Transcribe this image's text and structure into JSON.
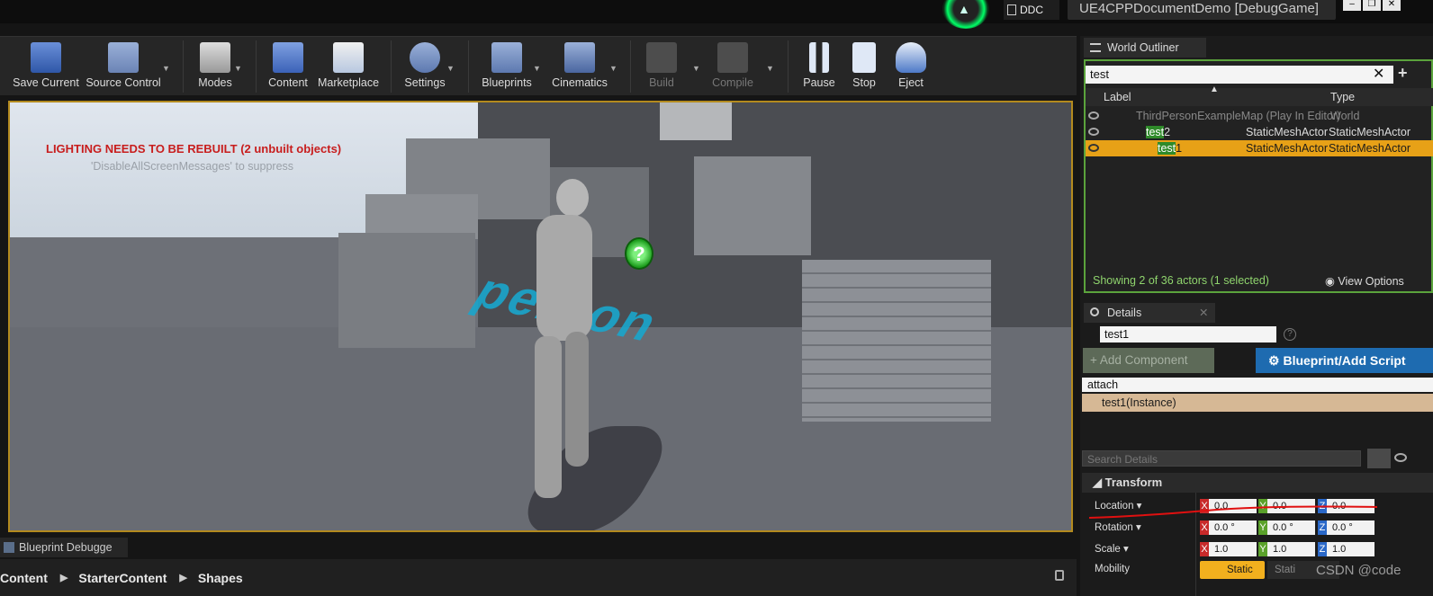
{
  "titlebar": {
    "ddc_label": "DDC",
    "project_tab": "UE4CPPDocumentDemo [DebugGame]",
    "win_buttons": [
      "–",
      "❐",
      "✕"
    ]
  },
  "toolbar": {
    "save": "Save Current",
    "source": "Source Control",
    "modes": "Modes",
    "content": "Content",
    "marketplace": "Marketplace",
    "settings": "Settings",
    "blueprints": "Blueprints",
    "cinematics": "Cinematics",
    "build": "Build",
    "compile": "Compile",
    "pause": "Pause",
    "stop": "Stop",
    "eject": "Eject"
  },
  "viewport": {
    "warning": "LIGHTING NEEDS TO BE REBUILT (2 unbuilt objects)",
    "hint": "'DisableAllScreenMessages' to suppress",
    "floor_text": "person",
    "marker": "?"
  },
  "bottom": {
    "tab": "Blueprint Debugge",
    "path": [
      "Content",
      "StarterContent",
      "Shapes"
    ]
  },
  "outliner": {
    "tab": "World Outliner",
    "search": "test",
    "col_label": "Label",
    "col_type": "Type",
    "rows": [
      {
        "label": "ThirdPersonExampleMap (Play In Editor)",
        "type": "World"
      },
      {
        "hl": "test",
        "rest": "2",
        "type1": "StaticMeshActor",
        "type2": "StaticMeshActor"
      },
      {
        "hl": "test",
        "rest": "1",
        "type1": "StaticMeshActor",
        "type2": "StaticMeshActor"
      }
    ],
    "footer": "Showing 2 of 36 actors (1 selected)",
    "view_options": "View Options"
  },
  "details": {
    "tab": "Details",
    "name": "test1",
    "add_component": "+ Add Component",
    "blueprint": "Blueprint/Add Script",
    "filter": "attach",
    "instance": "test1(Instance)",
    "search_placeholder": "Search Details",
    "transform": "Transform",
    "location": "Location",
    "rotation": "Rotation",
    "scale": "Scale",
    "mobility": "Mobility",
    "loc": [
      "0.0",
      "0.0",
      "0.0"
    ],
    "rot": [
      "0.0 °",
      "0.0 °",
      "0.0 °"
    ],
    "scl": [
      "1.0",
      "1.0",
      "1.0"
    ],
    "static": "Static",
    "stationary": "Stati"
  },
  "watermark": "CSDN @code"
}
